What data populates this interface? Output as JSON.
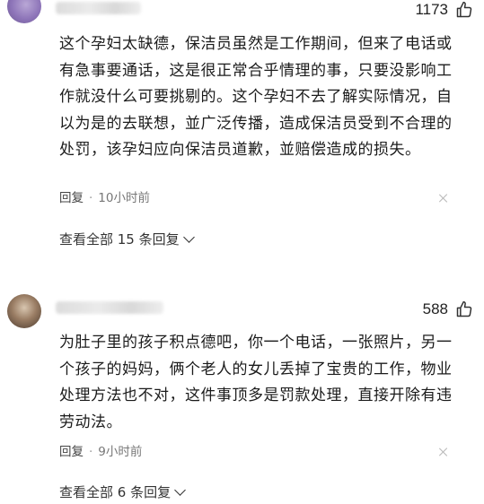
{
  "comments": [
    {
      "likes": "1173",
      "text": "这个孕妇太缺德，保洁员虽然是工作期间，但来了电话或有急事要通话，这是很正常合乎情理的事，只要没影响工作就没什么可要挑剔的。这个孕妇不去了解实际情况，自以为是的去联想，並广泛传播，造成保洁员受到不合理的处罚，该孕妇应向保洁员道歉，並赔偿造成的损失。",
      "reply_label": "回复",
      "time": "10小时前",
      "view_all": "查看全部 15 条回复"
    },
    {
      "likes": "588",
      "text": "为肚子里的孩子积点德吧，你一个电话，一张照片，另一个孩子的妈妈，俩个老人的女儿丢掉了宝贵的工作，物业处理方法也不对，这件事顶多是罚款处理，直接开除有违劳动法。",
      "reply_label": "回复",
      "time": "9小时前",
      "view_all": "查看全部 6 条回复"
    }
  ]
}
